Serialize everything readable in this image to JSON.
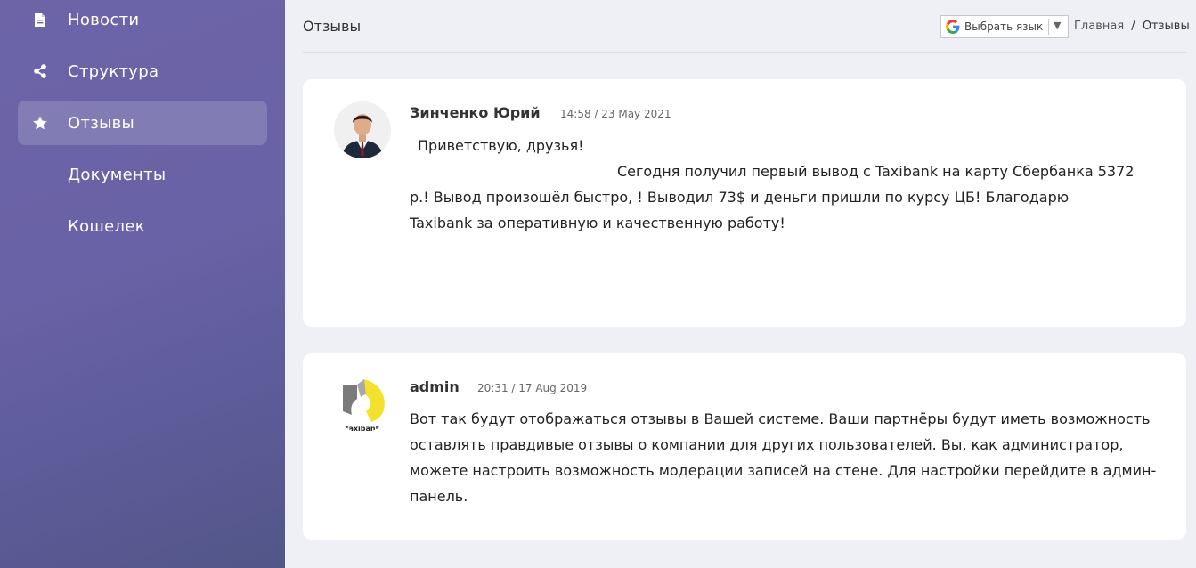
{
  "sidebar": {
    "items": [
      {
        "label": "Новости",
        "icon": "document-icon"
      },
      {
        "label": "Структура",
        "icon": "share-icon"
      },
      {
        "label": "Отзывы",
        "icon": "star-icon",
        "active": true
      },
      {
        "label": "Документы",
        "icon": ""
      },
      {
        "label": "Кошелек",
        "icon": ""
      }
    ]
  },
  "header": {
    "title": "Отзывы",
    "language_select": "Выбрать язык",
    "breadcrumb": {
      "home": "Главная",
      "separator": "/",
      "current": "Отзывы"
    }
  },
  "reviews": [
    {
      "author": "Зинченко Юрий",
      "date": "14:58 / 23 May 2021",
      "line1": "Приветствую, друзья!",
      "line2": "Сегодня получил первый вывод с Taxibank на карту Сбербанка 5372",
      "line3": "р.! Вывод произошёл быстро, ! Выводил 73$ и деньги пришли по курсу ЦБ! Благодарю",
      "line4": "Taxibank за оперативную и качественную работу!"
    },
    {
      "author": "admin",
      "date": "20:31 / 17 Aug 2019",
      "avatar_text": "Taxibank",
      "text": "Вот так будут отображаться отзывы в Вашей системе. Ваши партнёры будут иметь возможность оставлять правдивые отзывы о компании для других пользователей. Вы, как администратор, можете настроить возможность модерации записей на стене. Для настройки перейдите в админ-панель."
    }
  ],
  "colors": {
    "sidebar_top": "#6d64a8",
    "sidebar_bottom": "#525687",
    "background": "#eef0f5",
    "logo_yellow": "#f2e22e"
  }
}
